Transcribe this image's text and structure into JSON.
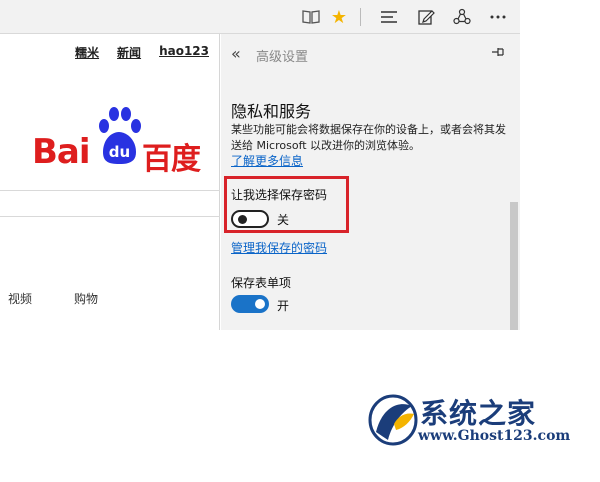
{
  "toolbar": {
    "icons": [
      "reading-view-icon",
      "favorite-star-icon",
      "hub-icon",
      "web-note-icon",
      "share-icon",
      "more-icon"
    ],
    "star_color": "#f4b400"
  },
  "page": {
    "top_links": [
      "糯米",
      "新闻",
      "hao123"
    ],
    "logo": {
      "latin": "Bai",
      "du": "du",
      "chinese": "百度",
      "color": "#de1e1e",
      "paw_color": "#2932e1"
    },
    "nav_links": [
      "视频",
      "购物"
    ]
  },
  "panel": {
    "title": "高级设置",
    "section_title": "隐私和服务",
    "section_desc": "某些功能可能会将数据保存在你的设备上，或者会将其发送给 Microsoft 以改进你的浏览体验。",
    "learn_more": "了解更多信息",
    "save_passwords_label": "让我选择保存密码",
    "save_passwords_state": "关",
    "manage_passwords": "管理我保存的密码",
    "form_entries_label": "保存表单项",
    "form_entries_state": "开",
    "highlight_color": "#d8232a",
    "toggle_on_color": "#1a73c8"
  },
  "watermark": {
    "title": "系统之家",
    "url": "www.Ghost123.com"
  }
}
